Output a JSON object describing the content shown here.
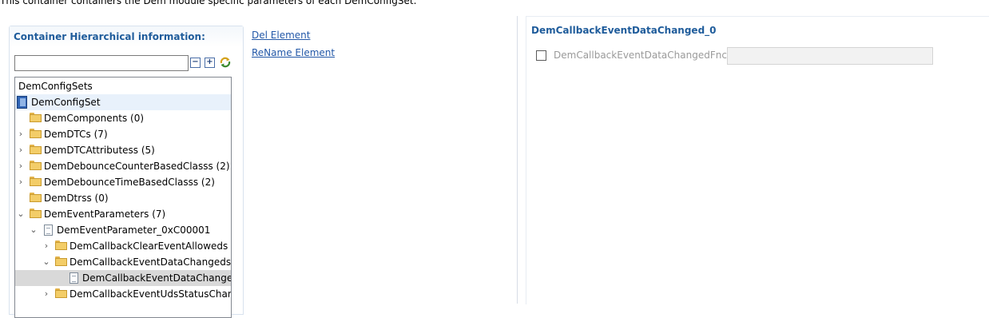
{
  "description": "This container containers the Dem module specific parameters of each DemConfigSet.",
  "hierarchy_panel": {
    "title": "Container Hierarchical information:",
    "filter_value": "",
    "tree": [
      {
        "label": "DemConfigSets",
        "icon": "none",
        "expand": "none"
      },
      {
        "label": "DemConfigSet",
        "icon": "config-book",
        "expand": "none"
      },
      {
        "label": "DemComponents (0)",
        "icon": "folder",
        "expand": "none"
      },
      {
        "label": "DemDTCs (7)",
        "icon": "folder",
        "expand": "collapsed"
      },
      {
        "label": "DemDTCAttributess (5)",
        "icon": "folder",
        "expand": "collapsed"
      },
      {
        "label": "DemDebounceCounterBasedClasss (2)",
        "icon": "folder",
        "expand": "collapsed"
      },
      {
        "label": "DemDebounceTimeBasedClasss (2)",
        "icon": "folder",
        "expand": "collapsed"
      },
      {
        "label": "DemDtrss (0)",
        "icon": "folder",
        "expand": "none"
      },
      {
        "label": "DemEventParameters (7)",
        "icon": "folder",
        "expand": "expanded"
      },
      {
        "label": "DemEventParameter_0xC00001",
        "icon": "document",
        "expand": "expanded"
      },
      {
        "label": "DemCallbackClearEventAlloweds (",
        "icon": "folder",
        "expand": "collapsed"
      },
      {
        "label": "DemCallbackEventDataChangeds (",
        "icon": "folder",
        "expand": "expanded"
      },
      {
        "label": "DemCallbackEventDataChangec",
        "icon": "document",
        "expand": "none"
      },
      {
        "label": "DemCallbackEventUdsStatusChang",
        "icon": "folder",
        "expand": "collapsed"
      }
    ]
  },
  "actions": {
    "delete_label": "Del Element",
    "rename_label": "ReName Element"
  },
  "detail_panel": {
    "title": "DemCallbackEventDataChanged_0",
    "field_label": "DemCallbackEventDataChangedFnc :",
    "field_value": "",
    "checkbox_checked": false
  },
  "colors": {
    "header_text": "#1f5c9b",
    "link": "#2358a8",
    "selection": "#d9d9d9",
    "highlight": "#e8f1fb"
  }
}
